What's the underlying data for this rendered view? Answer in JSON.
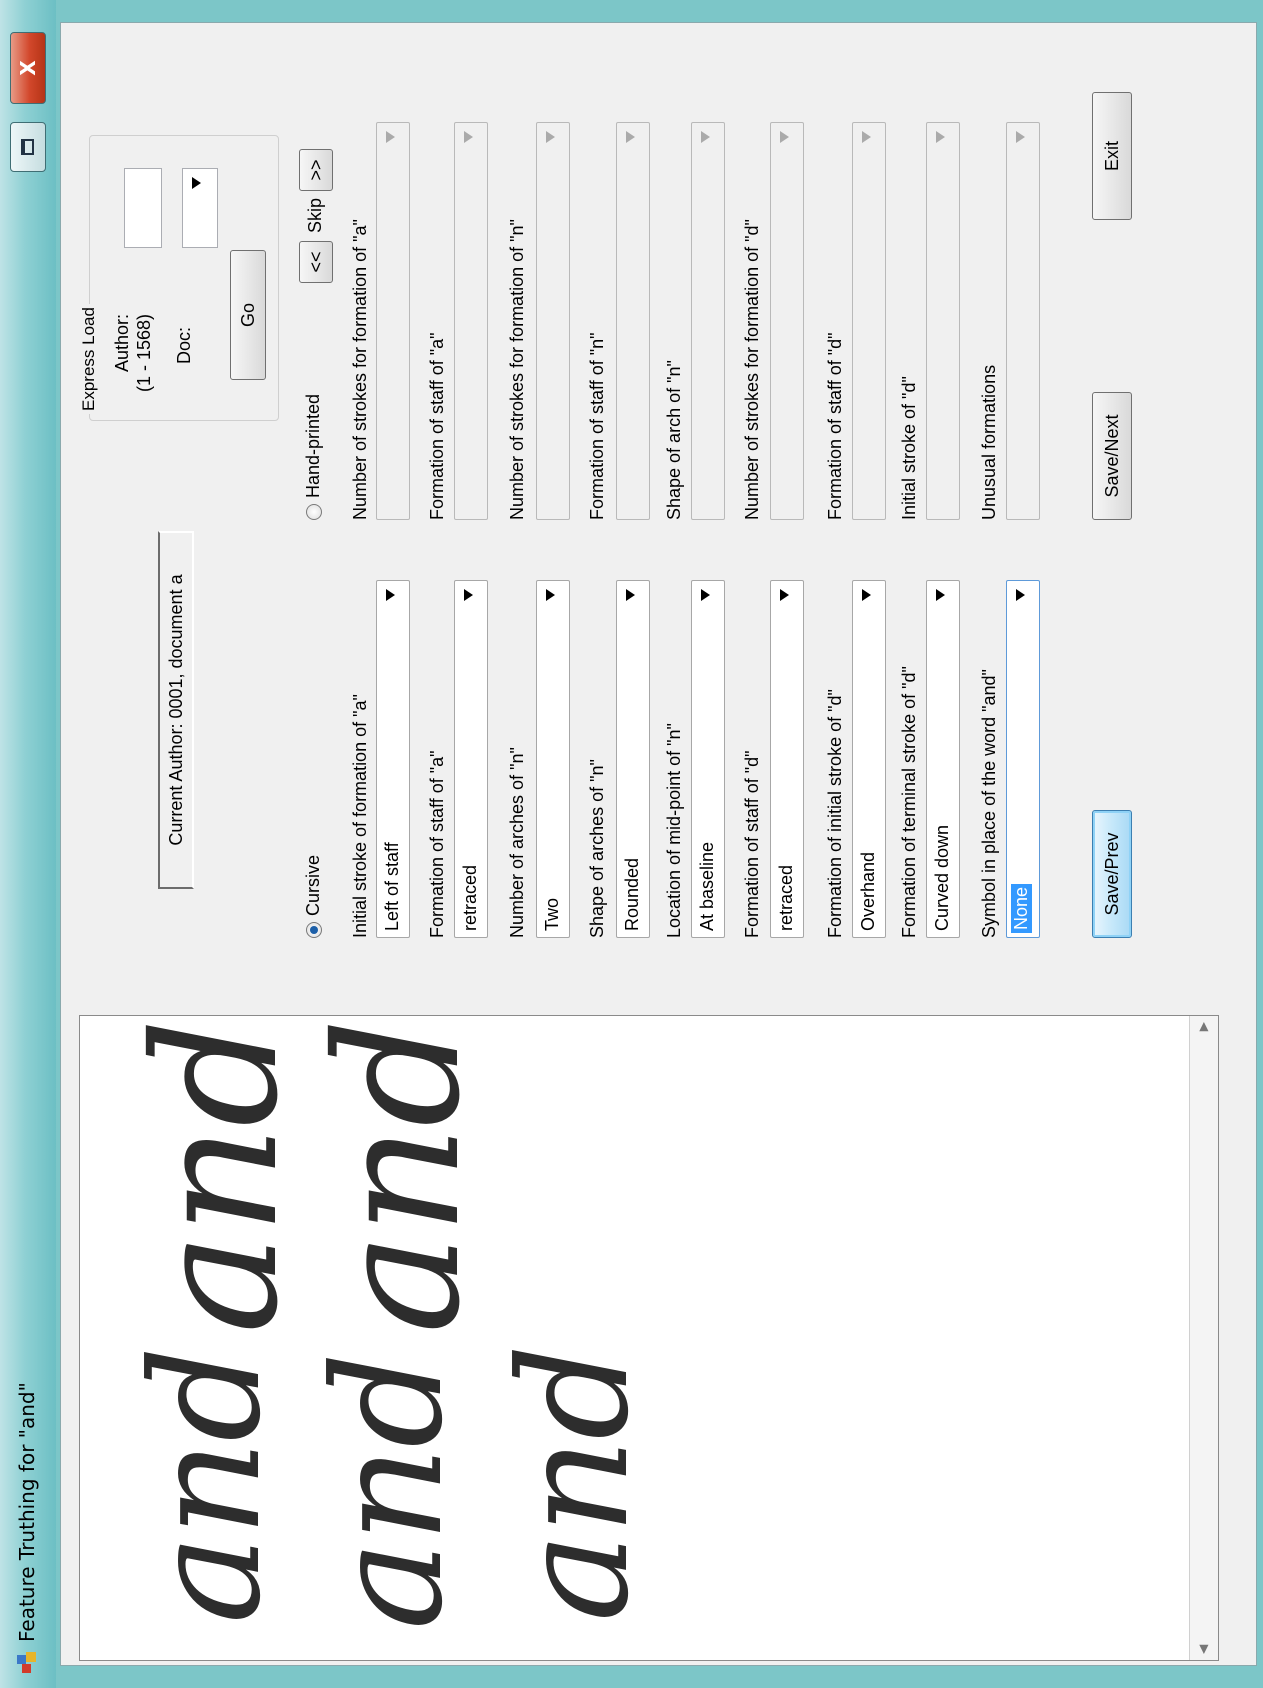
{
  "window": {
    "title": "Feature Truthing for \"and\"",
    "close_glyph": "X"
  },
  "viewer": {
    "words": [
      "and",
      "and",
      "and",
      "and",
      "and"
    ]
  },
  "status": {
    "current_author": "Current Author: 0001, document a"
  },
  "style_options": {
    "cursive": "Cursive",
    "hand_printed": "Hand-printed",
    "selected": "Cursive"
  },
  "express_load": {
    "title": "Express Load",
    "author_label": "Author:",
    "author_range": "(1 - 1568)",
    "doc_label": "Doc:",
    "author_value": "",
    "doc_value": "",
    "go": "Go"
  },
  "navigation": {
    "prev": "<<",
    "skip": "Skip",
    "next": ">>"
  },
  "cursive_fields": [
    {
      "label": "Initial stroke of formation of \"a\"",
      "value": "Left of staff"
    },
    {
      "label": "Formation of staff of \"a\"",
      "value": "retraced"
    },
    {
      "label": "Number of arches of \"n\"",
      "value": "Two"
    },
    {
      "label": "Shape of arches of \"n\"",
      "value": "Rounded"
    },
    {
      "label": "Location of mid-point of \"n\"",
      "value": "At baseline"
    },
    {
      "label": "Formation of staff of \"d\"",
      "value": "retraced"
    },
    {
      "label": "Formation of initial stroke of \"d\"",
      "value": "Overhand"
    },
    {
      "label": "Formation of terminal stroke of \"d\"",
      "value": "Curved down"
    },
    {
      "label": "Symbol in place of the word \"and\"",
      "value": "None"
    }
  ],
  "handprinted_fields": [
    {
      "label": "Number of strokes for formation of \"a\"",
      "value": ""
    },
    {
      "label": "Formation of staff of \"a\"",
      "value": ""
    },
    {
      "label": "Number of strokes for formation of \"n\"",
      "value": ""
    },
    {
      "label": "Formation of staff of \"n\"",
      "value": ""
    },
    {
      "label": "Shape of arch of \"n\"",
      "value": ""
    },
    {
      "label": "Number of strokes for formation of \"d\"",
      "value": ""
    },
    {
      "label": "Formation of staff of \"d\"",
      "value": ""
    },
    {
      "label": "Initial stroke of \"d\"",
      "value": ""
    },
    {
      "label": "Unusual formations",
      "value": ""
    }
  ],
  "buttons": {
    "save_prev": "Save/Prev",
    "save_next": "Save/Next",
    "exit": "Exit"
  }
}
